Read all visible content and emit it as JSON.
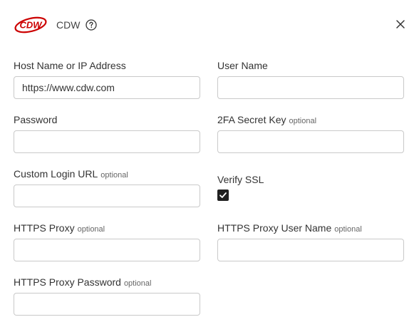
{
  "header": {
    "logo_text": "CDW",
    "title": "CDW",
    "brand_color": "#cc0000",
    "help_icon": "help-circle-icon",
    "close_icon": "close-icon"
  },
  "fields": {
    "host": {
      "label": "Host Name or IP Address",
      "value": "https://www.cdw.com"
    },
    "username": {
      "label": "User Name",
      "value": ""
    },
    "password": {
      "label": "Password",
      "value": ""
    },
    "twofa": {
      "label": "2FA Secret Key",
      "optional": "optional",
      "value": ""
    },
    "custom_login": {
      "label": "Custom Login URL",
      "optional": "optional",
      "value": ""
    },
    "verify_ssl": {
      "label": "Verify SSL",
      "checked": true
    },
    "https_proxy": {
      "label": "HTTPS Proxy",
      "optional": "optional",
      "value": ""
    },
    "proxy_user": {
      "label": "HTTPS Proxy User Name",
      "optional": "optional",
      "value": ""
    },
    "proxy_password": {
      "label": "HTTPS Proxy Password",
      "optional": "optional",
      "value": ""
    }
  }
}
